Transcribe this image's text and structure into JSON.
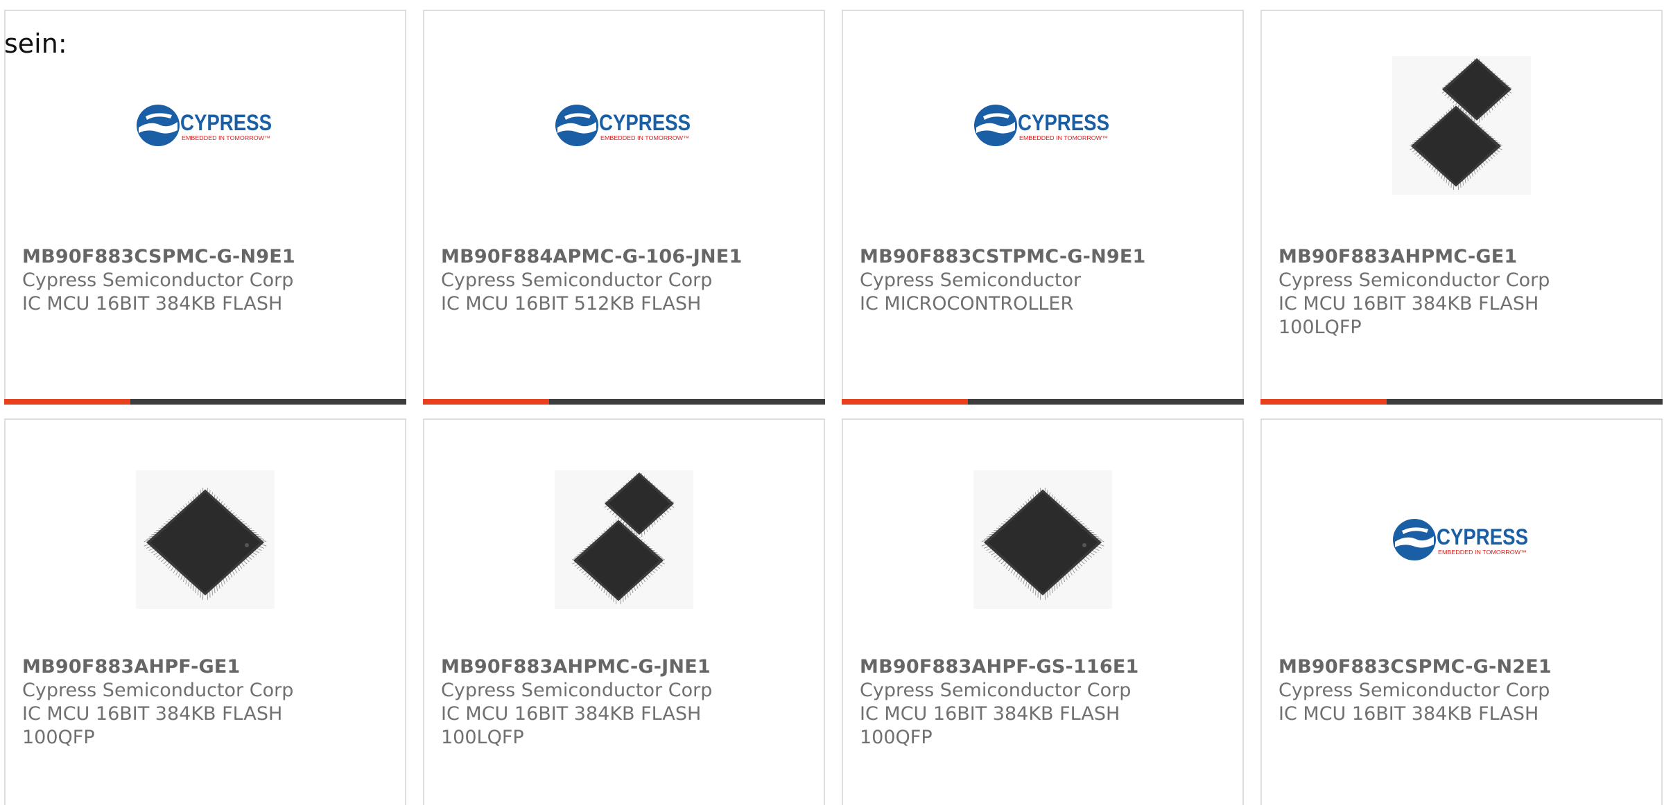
{
  "intro_text": "sein:",
  "colors": {
    "accent": "#e8401c",
    "bar_dark": "#3d3d3d",
    "border": "#dedede",
    "cypress_blue": "#1a5ea6",
    "cypress_red": "#d42020"
  },
  "products": [
    {
      "part": "MB90F883CSPMC-G-N9E1",
      "manufacturer": "Cypress Semiconductor Corp",
      "description": [
        "IC MCU 16BIT 384KB FLASH"
      ],
      "image": "cypress-logo"
    },
    {
      "part": "MB90F884APMC-G-106-JNE1",
      "manufacturer": "Cypress Semiconductor Corp",
      "description": [
        "IC MCU 16BIT 512KB FLASH"
      ],
      "image": "cypress-logo"
    },
    {
      "part": "MB90F883CSTPMC-G-N9E1",
      "manufacturer": "Cypress Semiconductor",
      "description": [
        "IC MICROCONTROLLER"
      ],
      "image": "cypress-logo"
    },
    {
      "part": "MB90F883AHPMC-GE1",
      "manufacturer": "Cypress Semiconductor Corp",
      "description": [
        "IC MCU 16BIT 384KB FLASH",
        "100LQFP"
      ],
      "image": "lqfp-two-chips"
    },
    {
      "part": "MB90F883AHPF-GE1",
      "manufacturer": "Cypress Semiconductor Corp",
      "description": [
        "IC MCU 16BIT 384KB FLASH",
        "100QFP"
      ],
      "image": "qfp-chip"
    },
    {
      "part": "MB90F883AHPMC-G-JNE1",
      "manufacturer": "Cypress Semiconductor Corp",
      "description": [
        "IC MCU 16BIT 384KB FLASH",
        "100LQFP"
      ],
      "image": "lqfp-two-chips"
    },
    {
      "part": "MB90F883AHPF-GS-116E1",
      "manufacturer": "Cypress Semiconductor Corp",
      "description": [
        "IC MCU 16BIT 384KB FLASH",
        "100QFP"
      ],
      "image": "qfp-chip"
    },
    {
      "part": "MB90F883CSPMC-G-N2E1",
      "manufacturer": "Cypress Semiconductor Corp",
      "description": [
        "IC MCU 16BIT 384KB FLASH"
      ],
      "image": "cypress-logo"
    }
  ],
  "logo": {
    "brand": "CYPRESS",
    "tagline": "EMBEDDED IN TOMORROW™"
  }
}
